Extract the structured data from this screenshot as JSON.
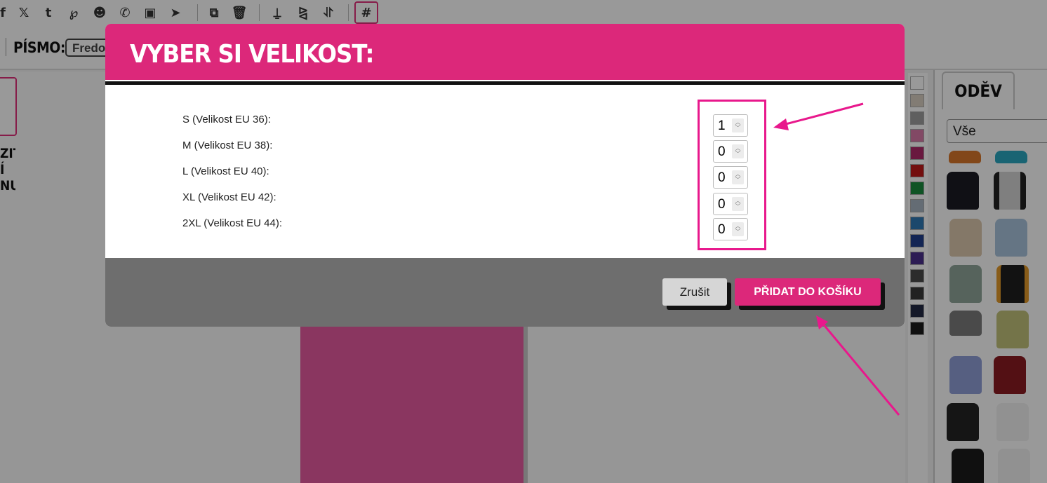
{
  "toolbar": {
    "icons": [
      "facebook-icon",
      "x-icon",
      "tumblr-icon",
      "pinterest-icon",
      "reddit-icon",
      "whatsapp-icon",
      "teams-icon",
      "telegram-icon",
      "duplicate-icon",
      "trash-icon",
      "align-center-icon",
      "flip-horizontal-icon",
      "flip-vertical-icon",
      "grid-icon"
    ]
  },
  "fontbar": {
    "label": "PÍSMO:",
    "font_value": "Fredo"
  },
  "left_tool": {
    "label_lines": [
      "ZIT",
      "Í",
      "NU"
    ]
  },
  "right_panel": {
    "tab_label": "ODĚV",
    "filter_value": "Vše"
  },
  "swatch_colors": [
    "#ffffff",
    "#d9cfc2",
    "#9e9e9e",
    "#d97aa8",
    "#b0286a",
    "#c01818",
    "#1a8a3c",
    "#a7b4c2",
    "#2f78b5",
    "#213e8c",
    "#4a2f8c",
    "#4a4a4a",
    "#3a3a3a",
    "#222844",
    "#1b1b1b"
  ],
  "modal": {
    "title": "VYBER SI VELIKOST:",
    "sizes": [
      {
        "label": "S (Velikost EU 36):",
        "qty": "1"
      },
      {
        "label": "M (Velikost EU 38):",
        "qty": "0"
      },
      {
        "label": "L (Velikost EU 40):",
        "qty": "0"
      },
      {
        "label": "XL (Velikost EU 42):",
        "qty": "0"
      },
      {
        "label": "2XL (Velikost EU 44):",
        "qty": "0"
      }
    ],
    "cancel_label": "Zrušit",
    "add_label": "PŘIDAT DO KOŠÍKU"
  },
  "colors": {
    "accent": "#dc287a",
    "annotation": "#e8188c",
    "footer": "#6e6e6e"
  }
}
